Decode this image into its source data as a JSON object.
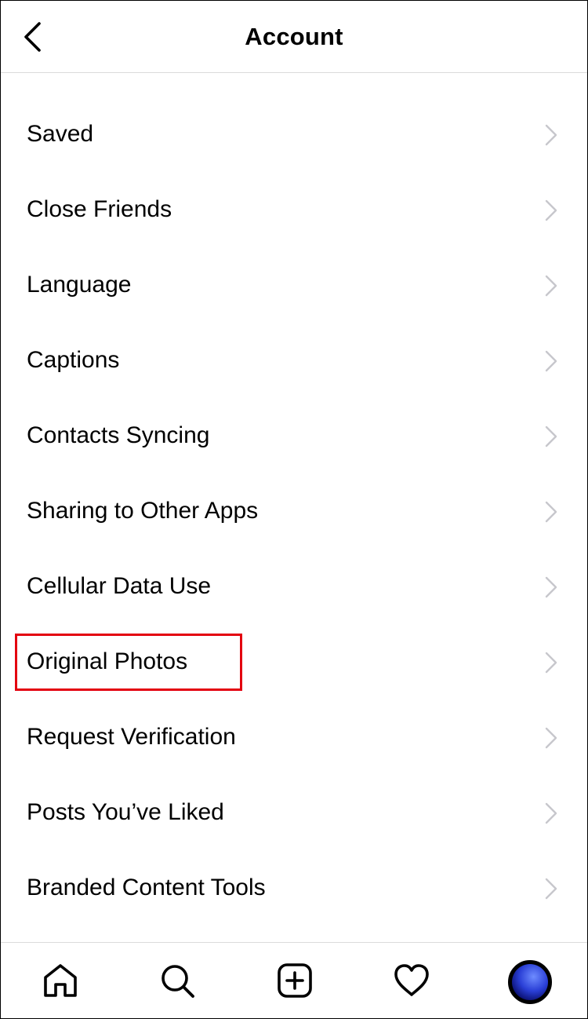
{
  "header": {
    "title": "Account",
    "back_icon": "chevron-left-icon"
  },
  "menu": {
    "items": [
      {
        "label": "Saved"
      },
      {
        "label": "Close Friends"
      },
      {
        "label": "Language"
      },
      {
        "label": "Captions"
      },
      {
        "label": "Contacts Syncing"
      },
      {
        "label": "Sharing to Other Apps"
      },
      {
        "label": "Cellular Data Use"
      },
      {
        "label": "Original Photos",
        "highlighted": true
      },
      {
        "label": "Request Verification"
      },
      {
        "label": "Posts You’ve Liked"
      },
      {
        "label": "Branded Content Tools"
      }
    ],
    "chevron_icon": "chevron-right-icon",
    "highlight_color": "#e3000f"
  },
  "tabbar": {
    "tabs": [
      {
        "icon": "home-icon"
      },
      {
        "icon": "search-icon"
      },
      {
        "icon": "new-post-icon"
      },
      {
        "icon": "heart-icon"
      },
      {
        "icon": "profile-avatar"
      }
    ]
  },
  "colors": {
    "background": "#ffffff",
    "text": "#000000",
    "chevron": "#c7c7cc",
    "divider": "#dbdbdb"
  }
}
